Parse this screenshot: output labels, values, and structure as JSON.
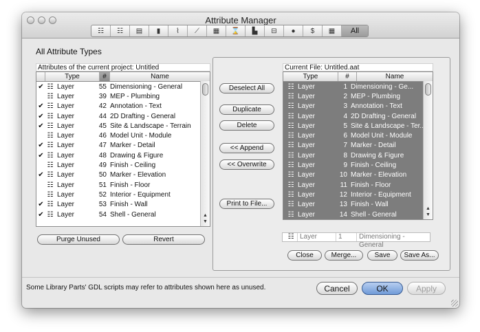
{
  "window": {
    "title": "Attribute Manager",
    "toolbar": {
      "icons": [
        "layers-icon",
        "line-types-icon",
        "fill-types-icon",
        "pens-icon",
        "composite-icon",
        "profile-icon",
        "materials-icon",
        "zones-icon",
        "building-materials-icon",
        "markup-icon",
        "city-icon",
        "mep-icon",
        "operation-profile-icon"
      ],
      "glyphs": [
        "☷",
        "☷",
        "▤",
        "▮",
        "⌇",
        "⟋",
        "▦",
        "⌛",
        "▙",
        "⊟",
        "●",
        "$",
        "▦"
      ],
      "all_label": "All"
    }
  },
  "section_title": "All Attribute Types",
  "left_panel": {
    "caption": "Attributes of the current project: Untitled",
    "columns": [
      "Type",
      "#",
      "Name"
    ],
    "rows": [
      {
        "check": "✔",
        "type": "Layer",
        "num": "55",
        "name": "Dimensioning - General"
      },
      {
        "check": "",
        "type": "Layer",
        "num": "39",
        "name": "MEP - Plumbing"
      },
      {
        "check": "✔",
        "type": "Layer",
        "num": "42",
        "name": "Annotation - Text"
      },
      {
        "check": "✔",
        "type": "Layer",
        "num": "44",
        "name": "2D Drafting - General"
      },
      {
        "check": "✔",
        "type": "Layer",
        "num": "45",
        "name": "Site & Landscape - Terrain"
      },
      {
        "check": "",
        "type": "Layer",
        "num": "46",
        "name": "Model Unit - Module"
      },
      {
        "check": "✔",
        "type": "Layer",
        "num": "47",
        "name": "Marker - Detail"
      },
      {
        "check": "✔",
        "type": "Layer",
        "num": "48",
        "name": "Drawing & Figure"
      },
      {
        "check": "",
        "type": "Layer",
        "num": "49",
        "name": "Finish - Ceiling"
      },
      {
        "check": "✔",
        "type": "Layer",
        "num": "50",
        "name": "Marker - Elevation"
      },
      {
        "check": "",
        "type": "Layer",
        "num": "51",
        "name": "Finish - Floor"
      },
      {
        "check": "",
        "type": "Layer",
        "num": "52",
        "name": "Interior - Equipment"
      },
      {
        "check": "✔",
        "type": "Layer",
        "num": "53",
        "name": "Finish - Wall"
      },
      {
        "check": "✔",
        "type": "Layer",
        "num": "54",
        "name": "Shell - General"
      }
    ],
    "purge_label": "Purge Unused",
    "revert_label": "Revert"
  },
  "middle_buttons": {
    "deselect_all": "Deselect All",
    "duplicate": "Duplicate",
    "delete": "Delete",
    "append": "<< Append",
    "overwrite": "<< Overwrite",
    "print": "Print to File..."
  },
  "right_panel": {
    "caption": "Current File: Untitled.aat",
    "columns": [
      "Type",
      "#",
      "Name"
    ],
    "rows": [
      {
        "type": "Layer",
        "num": "1",
        "name": "Dimensioning - Ge..."
      },
      {
        "type": "Layer",
        "num": "2",
        "name": "MEP - Plumbing"
      },
      {
        "type": "Layer",
        "num": "3",
        "name": "Annotation - Text"
      },
      {
        "type": "Layer",
        "num": "4",
        "name": "2D Drafting - General"
      },
      {
        "type": "Layer",
        "num": "5",
        "name": "Site & Landscape - Ter..."
      },
      {
        "type": "Layer",
        "num": "6",
        "name": "Model Unit - Module"
      },
      {
        "type": "Layer",
        "num": "7",
        "name": "Marker - Detail"
      },
      {
        "type": "Layer",
        "num": "8",
        "name": "Drawing & Figure"
      },
      {
        "type": "Layer",
        "num": "9",
        "name": "Finish - Ceiling"
      },
      {
        "type": "Layer",
        "num": "10",
        "name": "Marker - Elevation"
      },
      {
        "type": "Layer",
        "num": "11",
        "name": "Finish - Floor"
      },
      {
        "type": "Layer",
        "num": "12",
        "name": "Interior - Equipment"
      },
      {
        "type": "Layer",
        "num": "13",
        "name": "Finish - Wall"
      },
      {
        "type": "Layer",
        "num": "14",
        "name": "Shell - General"
      }
    ],
    "info": {
      "type": "Layer",
      "num": "1",
      "name": "Dimensioning - General"
    },
    "close_label": "Close",
    "merge_label": "Merge...",
    "save_label": "Save",
    "save_as_label": "Save As..."
  },
  "footer": {
    "note": "Some Library Parts' GDL scripts may refer to attributes shown here as unused.",
    "cancel_label": "Cancel",
    "ok_label": "OK",
    "apply_label": "Apply"
  },
  "colors": {
    "selected_list_bg": "#7d7d7d",
    "default_button": "#6f9ad8"
  }
}
